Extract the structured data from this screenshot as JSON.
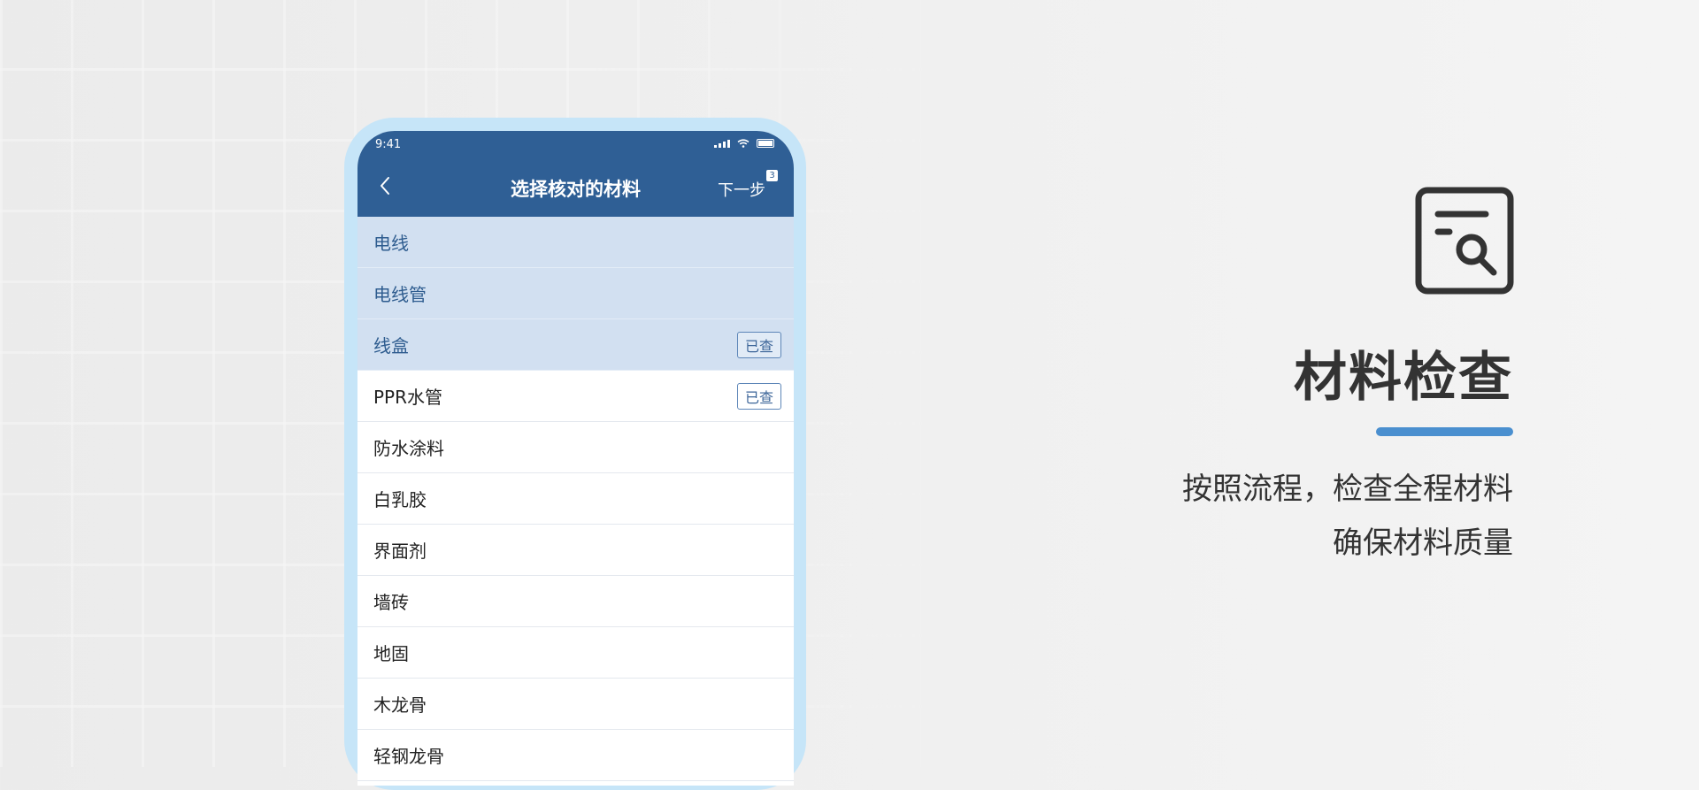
{
  "status_bar": {
    "time": "9:41"
  },
  "nav": {
    "title": "选择核对的材料",
    "next_label": "下一步",
    "next_badge": "3"
  },
  "materials": [
    {
      "name": "电线",
      "selected": true,
      "badge": ""
    },
    {
      "name": "电线管",
      "selected": true,
      "badge": ""
    },
    {
      "name": "线盒",
      "selected": true,
      "badge": "已查"
    },
    {
      "name": "PPR水管",
      "selected": false,
      "badge": "已查"
    },
    {
      "name": "防水涂料",
      "selected": false,
      "badge": ""
    },
    {
      "name": "白乳胶",
      "selected": false,
      "badge": ""
    },
    {
      "name": "界面剂",
      "selected": false,
      "badge": ""
    },
    {
      "name": "墙砖",
      "selected": false,
      "badge": ""
    },
    {
      "name": "地固",
      "selected": false,
      "badge": ""
    },
    {
      "name": "木龙骨",
      "selected": false,
      "badge": ""
    },
    {
      "name": "轻钢龙骨",
      "selected": false,
      "badge": ""
    }
  ],
  "feature": {
    "icon": "document-search-icon",
    "title": "材料检查",
    "subtitle_line1": "按照流程，检查全程材料",
    "subtitle_line2": "确保材料质量"
  },
  "colors": {
    "header": "#2f5f95",
    "selected_row": "#d2e0f1",
    "accent": "#4a8fcf",
    "phone_frame": "#c6e5f8"
  }
}
